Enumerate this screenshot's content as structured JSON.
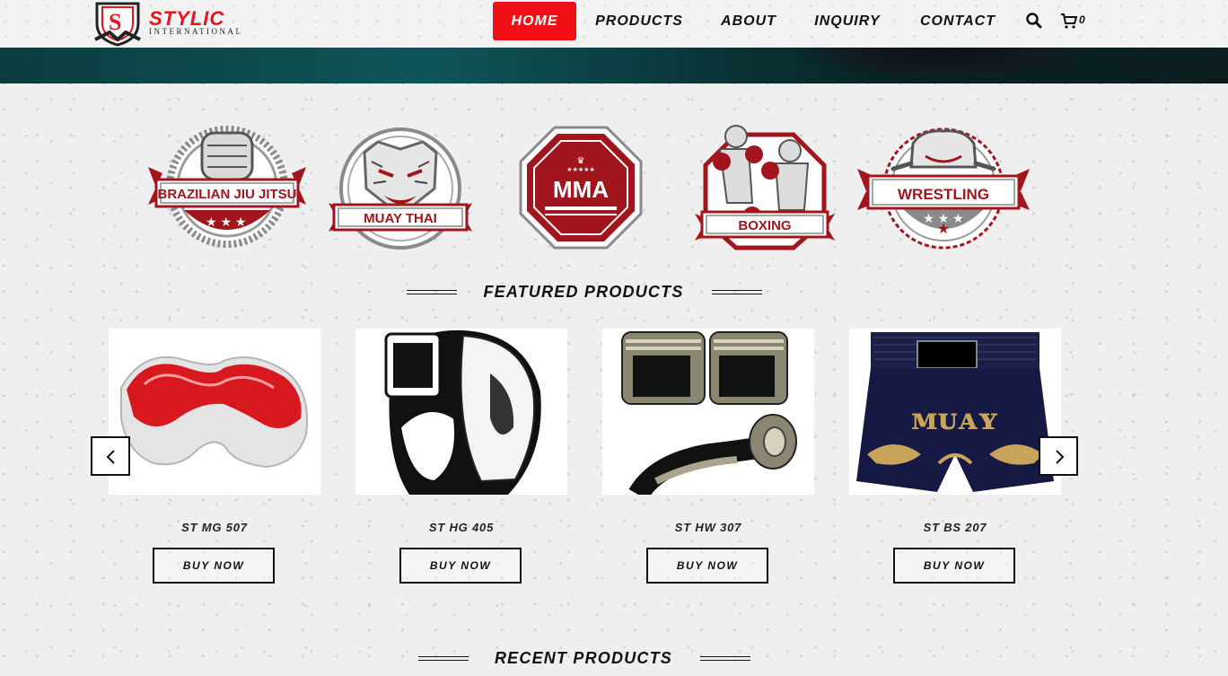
{
  "brand": {
    "name": "STYLIC",
    "subtitle": "INTERNATIONAL",
    "logo_icon": "shield-s-logo"
  },
  "nav": {
    "items": [
      {
        "label": "HOME",
        "active": true
      },
      {
        "label": "PRODUCTS",
        "active": false
      },
      {
        "label": "ABOUT",
        "active": false
      },
      {
        "label": "INQUIRY",
        "active": false
      },
      {
        "label": "CONTACT",
        "active": false
      }
    ],
    "search_icon": "search-icon",
    "cart_icon": "cart-icon",
    "cart_count": "0"
  },
  "categories": [
    {
      "label": "BRAZILIAN JIU JITSU",
      "icon": "fist-icon"
    },
    {
      "label": "MUAY THAI",
      "icon": "tiger-icon"
    },
    {
      "label": "MMA",
      "icon": "octagon-icon"
    },
    {
      "label": "BOXING",
      "icon": "boxers-icon"
    },
    {
      "label": "WRESTLING",
      "icon": "bear-icon"
    }
  ],
  "featured": {
    "title": "FEATURED PRODUCTS",
    "products": [
      {
        "name": "ST MG 507",
        "button": "BUY NOW",
        "image": "mouthguard"
      },
      {
        "name": "ST HG 405",
        "button": "BUY NOW",
        "image": "headguard"
      },
      {
        "name": "ST HW 307",
        "button": "BUY NOW",
        "image": "hand-wraps"
      },
      {
        "name": "ST BS 207",
        "button": "BUY NOW",
        "image": "boxing-shorts"
      }
    ],
    "prev_icon": "chevron-left-icon",
    "next_icon": "chevron-right-icon"
  },
  "recent": {
    "title": "RECENT PRODUCTS"
  },
  "colors": {
    "accent": "#ef0f14",
    "badge_red": "#a3151c",
    "badge_grey": "#8a8a8a",
    "text": "#111111"
  }
}
